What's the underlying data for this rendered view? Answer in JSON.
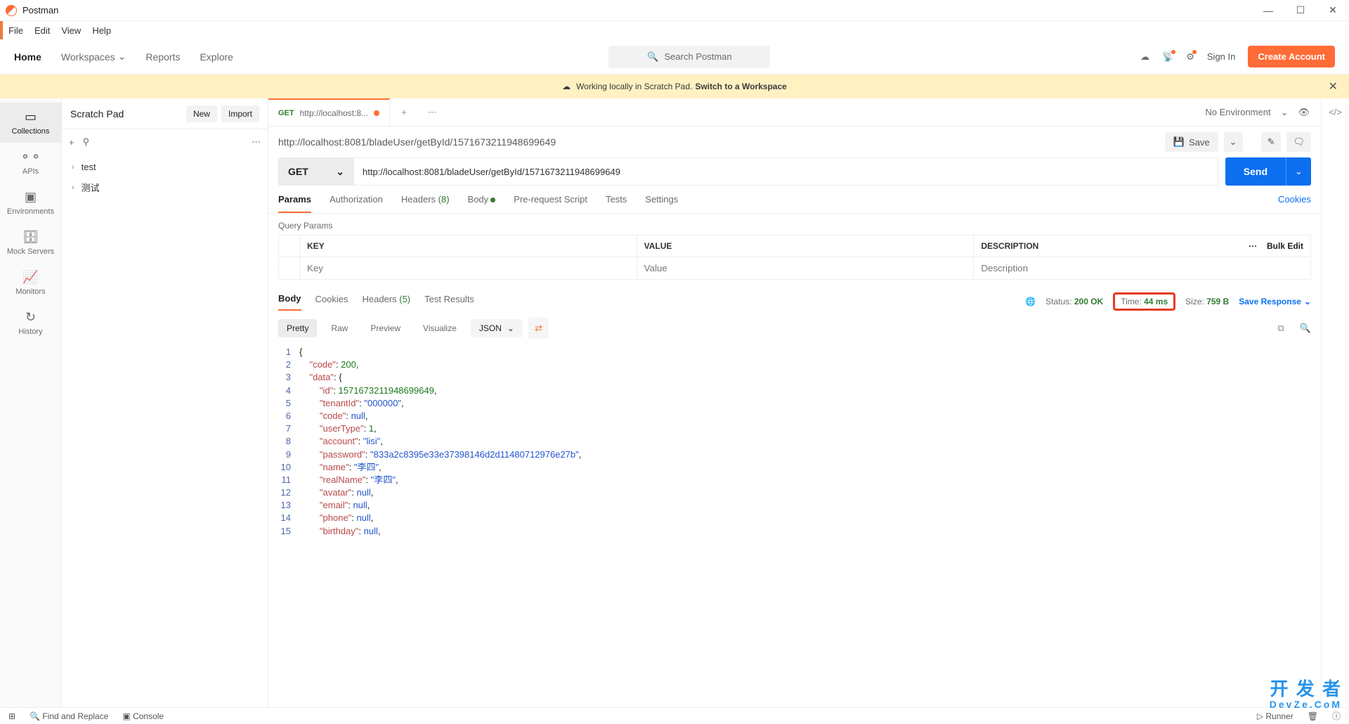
{
  "app": {
    "title": "Postman"
  },
  "menubar": [
    "File",
    "Edit",
    "View",
    "Help"
  ],
  "topnav": {
    "home": "Home",
    "workspaces": "Workspaces",
    "reports": "Reports",
    "explore": "Explore",
    "search_placeholder": "Search Postman",
    "signin": "Sign In",
    "create_account": "Create Account"
  },
  "banner": {
    "text": "Working locally in Scratch Pad.",
    "link": "Switch to a Workspace"
  },
  "scratchpad": {
    "title": "Scratch Pad",
    "new": "New",
    "import": "Import"
  },
  "siderail": [
    {
      "label": "Collections",
      "active": true
    },
    {
      "label": "APIs",
      "active": false
    },
    {
      "label": "Environments",
      "active": false
    },
    {
      "label": "Mock Servers",
      "active": false
    },
    {
      "label": "Monitors",
      "active": false
    },
    {
      "label": "History",
      "active": false
    }
  ],
  "tree": [
    {
      "name": "test"
    },
    {
      "name": "测试"
    }
  ],
  "tab": {
    "method": "GET",
    "label": "http://localhost:8..."
  },
  "env": {
    "selected": "No Environment"
  },
  "request": {
    "title": "http://localhost:8081/bladeUser/getById/1571673211948699649",
    "save": "Save",
    "method": "GET",
    "url": "http://localhost:8081/bladeUser/getById/1571673211948699649",
    "send": "Send",
    "tabs": {
      "params": "Params",
      "auth": "Authorization",
      "headers": "Headers",
      "headers_count": "(8)",
      "body": "Body",
      "prereq": "Pre-request Script",
      "tests": "Tests",
      "settings": "Settings",
      "cookies": "Cookies"
    },
    "qp_title": "Query Params",
    "cols": {
      "key": "KEY",
      "value": "VALUE",
      "desc": "DESCRIPTION"
    },
    "ph": {
      "key": "Key",
      "value": "Value",
      "desc": "Description"
    },
    "bulk": "Bulk Edit"
  },
  "response": {
    "tabs": {
      "body": "Body",
      "cookies": "Cookies",
      "headers": "Headers",
      "headers_count": "(5)",
      "tests": "Test Results"
    },
    "status_label": "Status:",
    "status": "200 OK",
    "time_label": "Time:",
    "time": "44 ms",
    "size_label": "Size:",
    "size": "759 B",
    "save": "Save Response",
    "view": {
      "pretty": "Pretty",
      "raw": "Raw",
      "preview": "Preview",
      "visualize": "Visualize",
      "format": "JSON"
    },
    "json_lines": [
      {
        "n": 1,
        "t": "{"
      },
      {
        "n": 2,
        "t": "    \"code\": 200,",
        "keys": [
          "code"
        ],
        "nums": [
          "200"
        ]
      },
      {
        "n": 3,
        "t": "    \"data\": {",
        "keys": [
          "data"
        ]
      },
      {
        "n": 4,
        "t": "        \"id\": 1571673211948699649,",
        "keys": [
          "id"
        ],
        "nums": [
          "1571673211948699649"
        ]
      },
      {
        "n": 5,
        "t": "        \"tenantId\": \"000000\",",
        "keys": [
          "tenantId"
        ],
        "strs": [
          "000000"
        ]
      },
      {
        "n": 6,
        "t": "        \"code\": null,",
        "keys": [
          "code"
        ],
        "nulls": true
      },
      {
        "n": 7,
        "t": "        \"userType\": 1,",
        "keys": [
          "userType"
        ],
        "nums": [
          "1"
        ]
      },
      {
        "n": 8,
        "t": "        \"account\": \"lisi\",",
        "keys": [
          "account"
        ],
        "strs": [
          "lisi"
        ]
      },
      {
        "n": 9,
        "t": "        \"password\": \"833a2c8395e33e37398146d2d11480712976e27b\",",
        "keys": [
          "password"
        ],
        "strs": [
          "833a2c8395e33e37398146d2d11480712976e27b"
        ]
      },
      {
        "n": 10,
        "t": "        \"name\": \"李四\",",
        "keys": [
          "name"
        ],
        "strs": [
          "李四"
        ]
      },
      {
        "n": 11,
        "t": "        \"realName\": \"李四\",",
        "keys": [
          "realName"
        ],
        "strs": [
          "李四"
        ]
      },
      {
        "n": 12,
        "t": "        \"avatar\": null,",
        "keys": [
          "avatar"
        ],
        "nulls": true
      },
      {
        "n": 13,
        "t": "        \"email\": null,",
        "keys": [
          "email"
        ],
        "nulls": true
      },
      {
        "n": 14,
        "t": "        \"phone\": null,",
        "keys": [
          "phone"
        ],
        "nulls": true
      },
      {
        "n": 15,
        "t": "        \"birthday\": null,",
        "keys": [
          "birthday"
        ],
        "nulls": true
      }
    ]
  },
  "statusbar": {
    "find": "Find and Replace",
    "console": "Console",
    "runner": "Runner"
  },
  "watermark": {
    "l1": "开 发 者",
    "l2": "DevZe.CoM"
  }
}
